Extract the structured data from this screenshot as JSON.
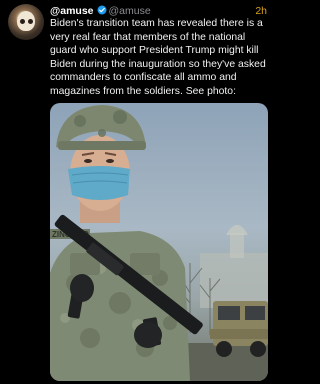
{
  "tweet": {
    "display_name": "@amuse",
    "handle": "@amuse",
    "timestamp": "2h",
    "text": "Biden's transition team has revealed there is a very real fear that members of the national guard who support President Trump might kill Biden during the inauguration so they've asked commanders to confiscate all ammo and magazines from the soldiers. See photo:",
    "verified_icon": "verified-badge-icon",
    "avatar_icon": "skull-avatar"
  },
  "photo": {
    "name_tape": "ZINGARO"
  },
  "colors": {
    "background": "#000000",
    "verified": "#1d9bf0",
    "timestamp": "#d8a31a",
    "handle": "#8a8d91"
  }
}
